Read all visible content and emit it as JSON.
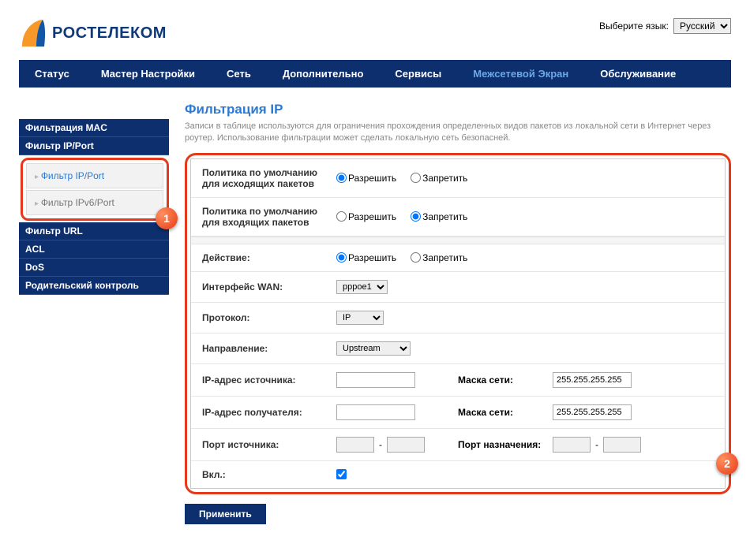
{
  "lang": {
    "label": "Выберите язык:",
    "selected": "Русский"
  },
  "logo": {
    "text": "РОСТЕЛЕКОМ"
  },
  "nav": [
    "Статус",
    "Мастер Настройки",
    "Сеть",
    "Дополнительно",
    "Сервисы",
    "Межсетевой Экран",
    "Обслуживание"
  ],
  "nav_active": 5,
  "sidebar": {
    "top": [
      "Фильтрация MAC",
      "Фильтр IP/Port"
    ],
    "sub": [
      "Фильтр IP/Port",
      "Фильтр IPv6/Port"
    ],
    "sub_active": 0,
    "bottom": [
      "Фильтр URL",
      "ACL",
      "DoS",
      "Родительский контроль"
    ]
  },
  "badges": {
    "one": "1",
    "two": "2"
  },
  "page": {
    "title": "Фильтрация IP",
    "desc": "Записи в таблице используются для ограничения прохождения определенных видов пакетов из локальной сети в Интернет через роутер. Использование фильтрации может сделать локальную сеть безопасней."
  },
  "labels": {
    "policy_out": "Политика по умолчанию для исходящих пакетов",
    "policy_in": "Политика по умолчанию для входящих пакетов",
    "allow": "Разрешить",
    "deny": "Запретить",
    "action": "Действие:",
    "wan": "Интерфейс WAN:",
    "proto": "Протокол:",
    "direction": "Направление:",
    "src_ip": "IP-адрес источника:",
    "dst_ip": "IP-адрес получателя:",
    "mask": "Маска сети:",
    "src_port": "Порт источника:",
    "dst_port": "Порт назначения:",
    "enable": "Вкл.:",
    "apply": "Применить"
  },
  "values": {
    "wan": "pppoe1",
    "proto": "IP",
    "direction": "Upstream",
    "mask1": "255.255.255.255",
    "mask2": "255.255.255.255"
  }
}
